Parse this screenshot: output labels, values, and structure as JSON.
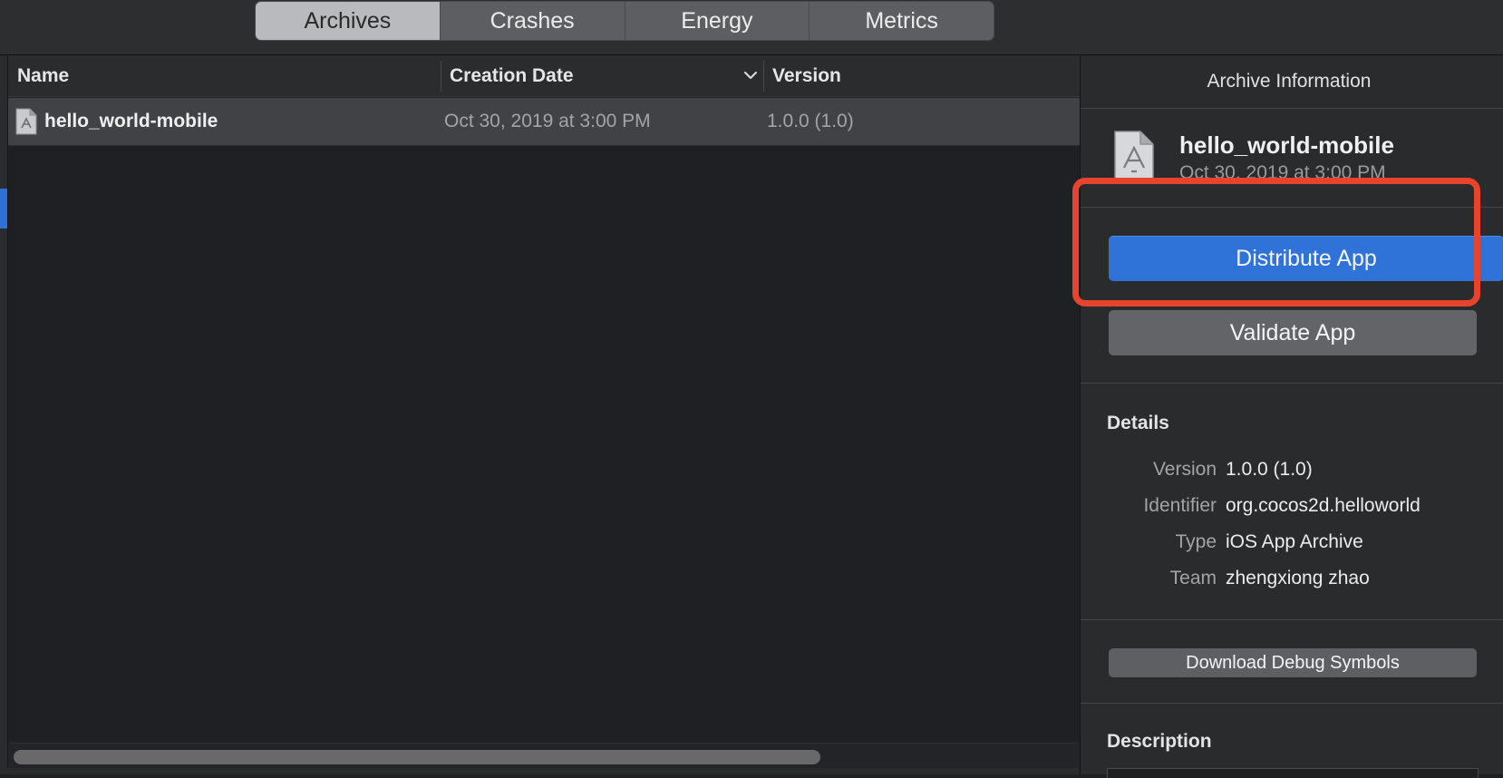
{
  "tabs": [
    {
      "label": "Archives",
      "active": true
    },
    {
      "label": "Crashes",
      "active": false
    },
    {
      "label": "Energy",
      "active": false
    },
    {
      "label": "Metrics",
      "active": false
    }
  ],
  "table": {
    "columns": {
      "name": "Name",
      "creation_date": "Creation Date",
      "version": "Version"
    },
    "rows": [
      {
        "name": "hello_world-mobile",
        "creation_date": "Oct 30, 2019 at 3:00 PM",
        "version": "1.0.0 (1.0)",
        "icon": "app-archive-icon"
      }
    ]
  },
  "inspector": {
    "title": "Archive Information",
    "archive_name": "hello_world-mobile",
    "archive_date": "Oct 30, 2019 at 3:00 PM",
    "distribute_label": "Distribute App",
    "validate_label": "Validate App",
    "details_heading": "Details",
    "details": [
      {
        "label": "Version",
        "value": "1.0.0 (1.0)"
      },
      {
        "label": "Identifier",
        "value": "org.cocos2d.helloworld"
      },
      {
        "label": "Type",
        "value": "iOS App Archive"
      },
      {
        "label": "Team",
        "value": "zhengxiong zhao"
      }
    ],
    "debug_symbols_label": "Download Debug Symbols",
    "description_heading": "Description"
  },
  "colors": {
    "accent": "#2f73d9",
    "highlight": "#e8432c",
    "background": "#1f2023"
  }
}
